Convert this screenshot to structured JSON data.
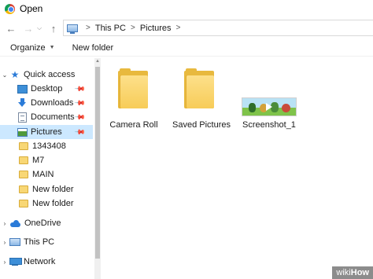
{
  "window": {
    "title": "Open",
    "app_icon": "chrome-icon"
  },
  "nav": {
    "back_icon": "back-arrow-icon",
    "forward_icon": "forward-arrow-icon",
    "history_icon": "chevron-down-icon",
    "up_icon": "up-arrow-icon",
    "breadcrumb": [
      "This PC",
      "Pictures"
    ],
    "separator": ">"
  },
  "toolbar": {
    "organize_label": "Organize",
    "new_folder_label": "New folder"
  },
  "sidebar": {
    "items": [
      {
        "label": "Quick access",
        "icon": "star-icon",
        "expand": "v"
      },
      {
        "label": "Desktop",
        "icon": "desktop-icon",
        "pinned": true
      },
      {
        "label": "Downloads",
        "icon": "download-icon",
        "pinned": true
      },
      {
        "label": "Documents",
        "icon": "documents-icon",
        "pinned": true
      },
      {
        "label": "Pictures",
        "icon": "pictures-icon",
        "pinned": true,
        "selected": true
      },
      {
        "label": "1343408",
        "icon": "folder-icon"
      },
      {
        "label": "M7",
        "icon": "folder-icon"
      },
      {
        "label": "MAIN",
        "icon": "folder-icon"
      },
      {
        "label": "New folder",
        "icon": "folder-icon"
      },
      {
        "label": "New folder",
        "icon": "folder-icon"
      },
      {
        "label": "OneDrive",
        "icon": "onedrive-icon",
        "expand": ">"
      },
      {
        "label": "This PC",
        "icon": "this-pc-icon",
        "expand": ">"
      },
      {
        "label": "Network",
        "icon": "network-icon",
        "expand": ">"
      }
    ]
  },
  "content": {
    "items": [
      {
        "name": "Camera Roll",
        "type": "folder"
      },
      {
        "name": "Saved Pictures",
        "type": "folder"
      },
      {
        "name": "Screenshot_1",
        "type": "image"
      }
    ]
  },
  "colors": {
    "selection": "#cce8ff",
    "folder": "#f7cc58",
    "accent": "#2b7bd8"
  },
  "watermark": {
    "prefix": "wiki",
    "suffix": "How"
  }
}
